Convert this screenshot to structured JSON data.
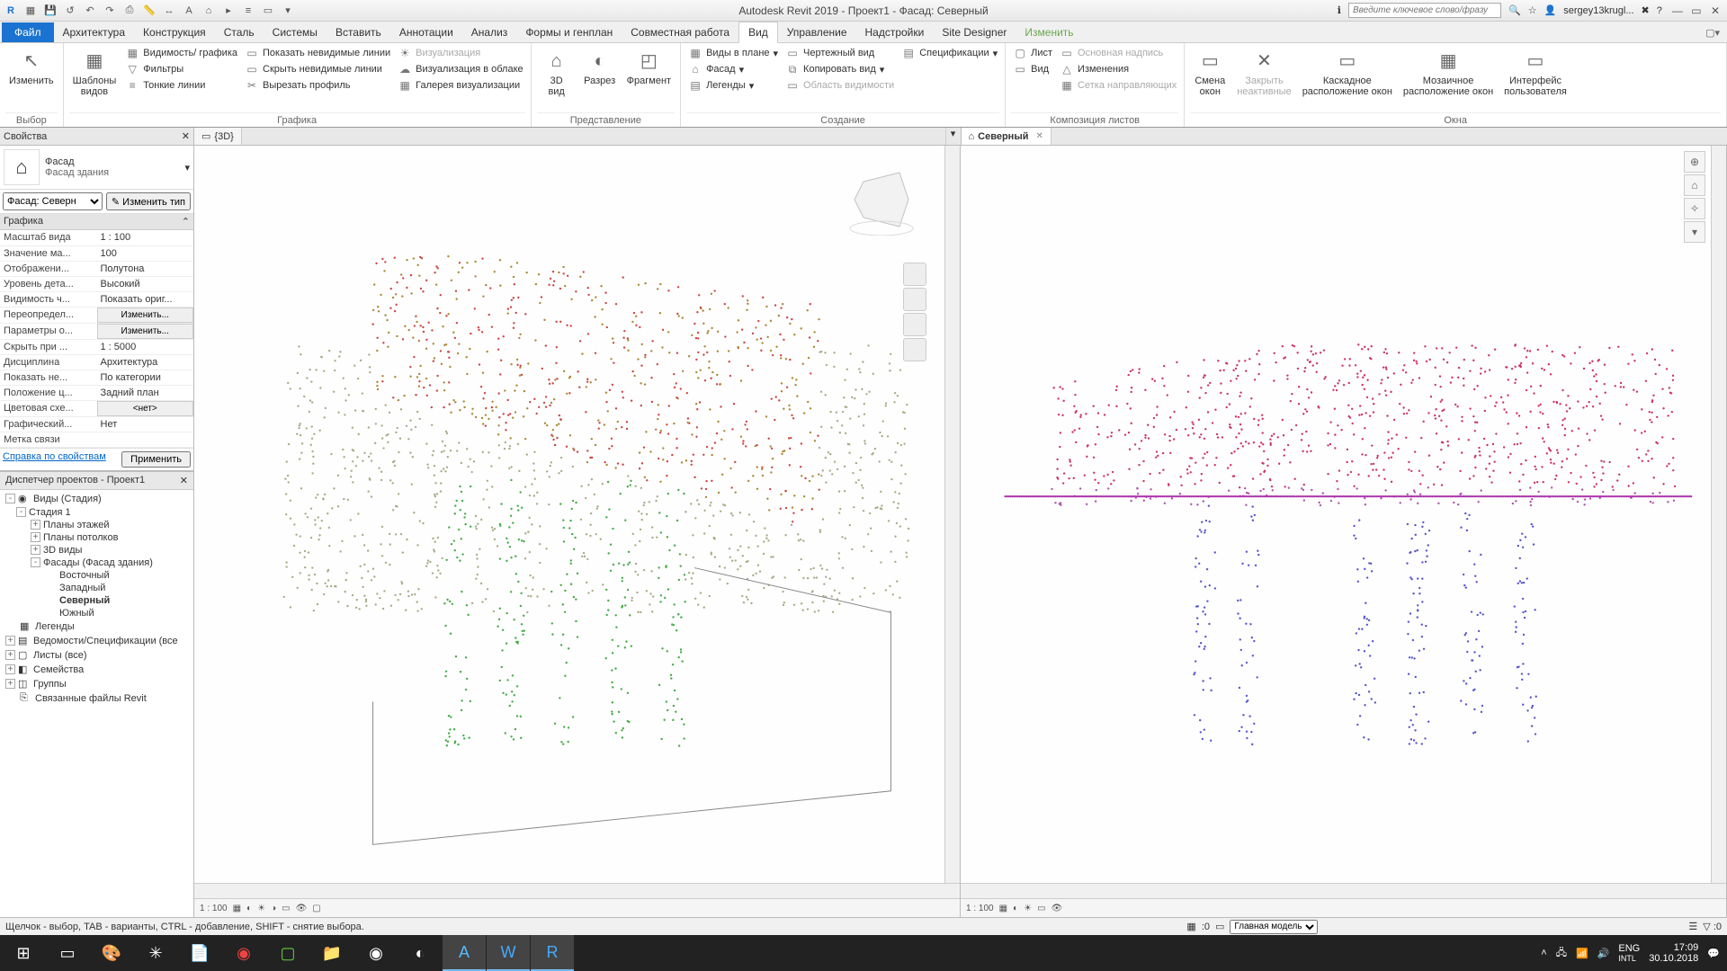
{
  "app": {
    "title": "Autodesk Revit 2019 - Проект1 - Фасад: Северный",
    "search_placeholder": "Введите ключевое слово/фразу",
    "user": "sergey13krugl..."
  },
  "tabs": {
    "file": "Файл",
    "items": [
      "Архитектура",
      "Конструкция",
      "Сталь",
      "Системы",
      "Вставить",
      "Аннотации",
      "Анализ",
      "Формы и генплан",
      "Совместная работа",
      "Вид",
      "Управление",
      "Надстройки",
      "Site Designer",
      "Изменить"
    ],
    "active": "Вид"
  },
  "ribbon": {
    "p0": {
      "label": "Выбор",
      "btn": "Изменить"
    },
    "p1": {
      "label": "Графика",
      "big": "Шаблоны\nвидов",
      "r1": "Видимость/ графика",
      "r2": "Фильтры",
      "r3": "Тонкие линии",
      "r4": "Показать невидимые линии",
      "r5": "Скрыть невидимые линии",
      "r6": "Вырезать профиль",
      "r7": "Визуализация",
      "r8": "Визуализация  в облаке",
      "r9": "Галерея  визуализации"
    },
    "p2": {
      "label": "Представление",
      "b1": "3D\nвид",
      "b2": "Разрез",
      "b3": "Фрагмент"
    },
    "p3": {
      "label": "Создание",
      "r1": "Виды в плане",
      "r2": "Фасад",
      "r3": "Легенды",
      "r4": "Чертежный вид",
      "r5": "Копировать вид",
      "r6": "Область видимости",
      "r7": "Спецификации"
    },
    "p4": {
      "label": "Композиция листов",
      "r1": "Лист",
      "r2": "Вид",
      "r3": "Основная надпись",
      "r4": "Изменения",
      "r5": "Сетка направляющих"
    },
    "p5": {
      "label": "Окна",
      "b1": "Смена\nокон",
      "b2": "Закрыть\nнеактивные",
      "b3": "Каскадное\nрасположение окон",
      "b4": "Мозаичное\nрасположение окон",
      "b5": "Интерфейс\nпользователя"
    }
  },
  "props": {
    "title": "Свойства",
    "type1": "Фасад",
    "type2": "Фасад здания",
    "selector": "Фасад: Северн",
    "edit_type": "Изменить тип",
    "group": "Графика",
    "rows": [
      [
        "Масштаб вида",
        "1 : 100"
      ],
      [
        "Значение ма...",
        "100"
      ],
      [
        "Отображени...",
        "Полутона"
      ],
      [
        "Уровень дета...",
        "Высокий"
      ],
      [
        "Видимость ч...",
        "Показать ориг..."
      ],
      [
        "Переопредел...",
        "Изменить..."
      ],
      [
        "Параметры о...",
        "Изменить..."
      ],
      [
        "Скрыть при ...",
        "1 : 5000"
      ],
      [
        "Дисциплина",
        "Архитектура"
      ],
      [
        "Показать не...",
        "По категории"
      ],
      [
        "Положение ц...",
        "Задний план"
      ],
      [
        "Цветовая схе...",
        "<нет>"
      ],
      [
        "Графический...",
        "Нет"
      ],
      [
        "Метка связи",
        ""
      ]
    ],
    "help": "Справка по свойствам",
    "apply": "Применить"
  },
  "browser": {
    "title": "Диспетчер проектов - Проект1",
    "nodes": [
      {
        "lvl": 0,
        "exp": "-",
        "label": "Виды (Стадия)",
        "icn": "◉"
      },
      {
        "lvl": 1,
        "exp": "-",
        "label": "Стадия 1"
      },
      {
        "lvl": 2,
        "exp": "+",
        "label": "Планы этажей"
      },
      {
        "lvl": 2,
        "exp": "+",
        "label": "Планы потолков"
      },
      {
        "lvl": 2,
        "exp": "+",
        "label": "3D виды"
      },
      {
        "lvl": 2,
        "exp": "-",
        "label": "Фасады (Фасад здания)"
      },
      {
        "lvl": 3,
        "label": "Восточный"
      },
      {
        "lvl": 3,
        "label": "Западный"
      },
      {
        "lvl": 3,
        "label": "Северный",
        "bold": true
      },
      {
        "lvl": 3,
        "label": "Южный"
      },
      {
        "lvl": 0,
        "icn": "▦",
        "label": "Легенды"
      },
      {
        "lvl": 0,
        "exp": "+",
        "icn": "▤",
        "label": "Ведомости/Спецификации (все"
      },
      {
        "lvl": 0,
        "exp": "+",
        "icn": "▢",
        "label": "Листы (все)"
      },
      {
        "lvl": 0,
        "exp": "+",
        "icn": "◧",
        "label": "Семейства"
      },
      {
        "lvl": 0,
        "exp": "+",
        "icn": "◫",
        "label": "Группы"
      },
      {
        "lvl": 0,
        "icn": "⎘",
        "label": "Связанные файлы Revit"
      }
    ]
  },
  "views": {
    "tab1": "{3D}",
    "tab2": "Северный",
    "scale": "1 : 100"
  },
  "status": {
    "hint": "Щелчок - выбор, TAB - варианты, CTRL - добавление, SHIFT - снятие выбора.",
    "model": "Главная модель",
    "filter": ":0"
  },
  "tray": {
    "lang": "ENG",
    "intl": "INTL",
    "time": "17:09",
    "date": "30.10.2018"
  }
}
